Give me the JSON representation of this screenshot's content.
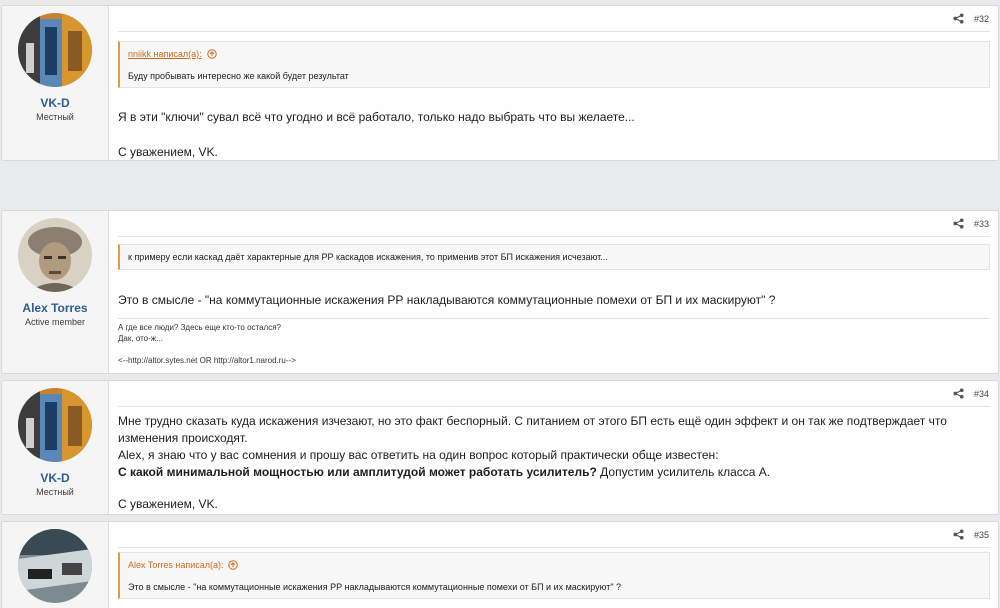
{
  "posts": [
    {
      "user": {
        "name": "VK-D",
        "title": "Местный"
      },
      "number": "#32",
      "quote": {
        "author": "nniikk написал(а):",
        "text": "Буду пробывать интересно же какой будет результат"
      },
      "lines": [
        "Я в эти \"ключи\" сувал всё что угодно и всё работало, только надо выбрать что вы желаете...",
        "С уважением, VK."
      ]
    },
    {
      "user": {
        "name": "Alex Torres",
        "title": "Active member"
      },
      "number": "#33",
      "quote": {
        "text": "к примеру если каскад даёт характерные для РР каскадов искажения, то применив этот БП искажения исчезают..."
      },
      "lines": [
        "Это в смысле - \"на коммутационные искажения РР накладываются коммутационные помехи от БП и их маскируют\" ?"
      ],
      "signature": [
        "А где все люди? Здесь еще кто-то остался?",
        "Дак, ото-ж...",
        "<--http://altor.sytes.net OR http://altor1.narod.ru-->"
      ]
    },
    {
      "user": {
        "name": "VK-D",
        "title": "Местный"
      },
      "number": "#34",
      "lines": [
        "Мне трудно сказать куда искажения изчезают, но это факт беспорный. С питанием от этого БП есть ещё один эффект и он так же подтверждает что изменения происходят.",
        "Alex, я знаю что у вас сомнения и прошу вас ответить на один вопрос который практически обще известен:",
        "С какой минимальной мощностью или амплитудой может работать усилитель?",
        "Допустим усилитель класса А.",
        "С уважением, VK."
      ]
    },
    {
      "number": "#35",
      "quote": {
        "author": "Alex Torres написал(а):",
        "text": "Это в смысле - \"на коммутационные искажения РР накладываются коммутационные помехи от БП и их маскируют\" ?"
      }
    }
  ],
  "colors": {
    "accent": "#2d5d8f",
    "quote_border": "#e39a4a",
    "quote_link": "#cc6b1c"
  },
  "icons": {
    "share": "share-icon",
    "quote_jump": "arrow-up-circle-icon"
  }
}
